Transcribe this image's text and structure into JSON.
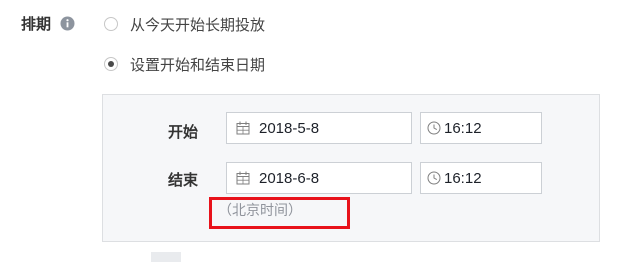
{
  "schedule": {
    "label": "排期",
    "info_icon": "info-icon",
    "options": [
      {
        "label": "从今天开始长期投放",
        "checked": false
      },
      {
        "label": "设置开始和结束日期",
        "checked": true
      }
    ],
    "start": {
      "label": "开始",
      "date": "2018-5-8",
      "time": "16:12",
      "date_icon": "calendar-icon",
      "time_icon": "clock-icon"
    },
    "end": {
      "label": "结束",
      "date": "2018-6-8",
      "time": "16:12",
      "date_icon": "calendar-icon",
      "time_icon": "clock-icon"
    },
    "timezone_note": "（北京时间）"
  },
  "colors": {
    "highlight_border": "#e8121b",
    "panel_background": "#f6f7f9",
    "panel_border": "#dddfe2",
    "note_text": "#90949c"
  }
}
